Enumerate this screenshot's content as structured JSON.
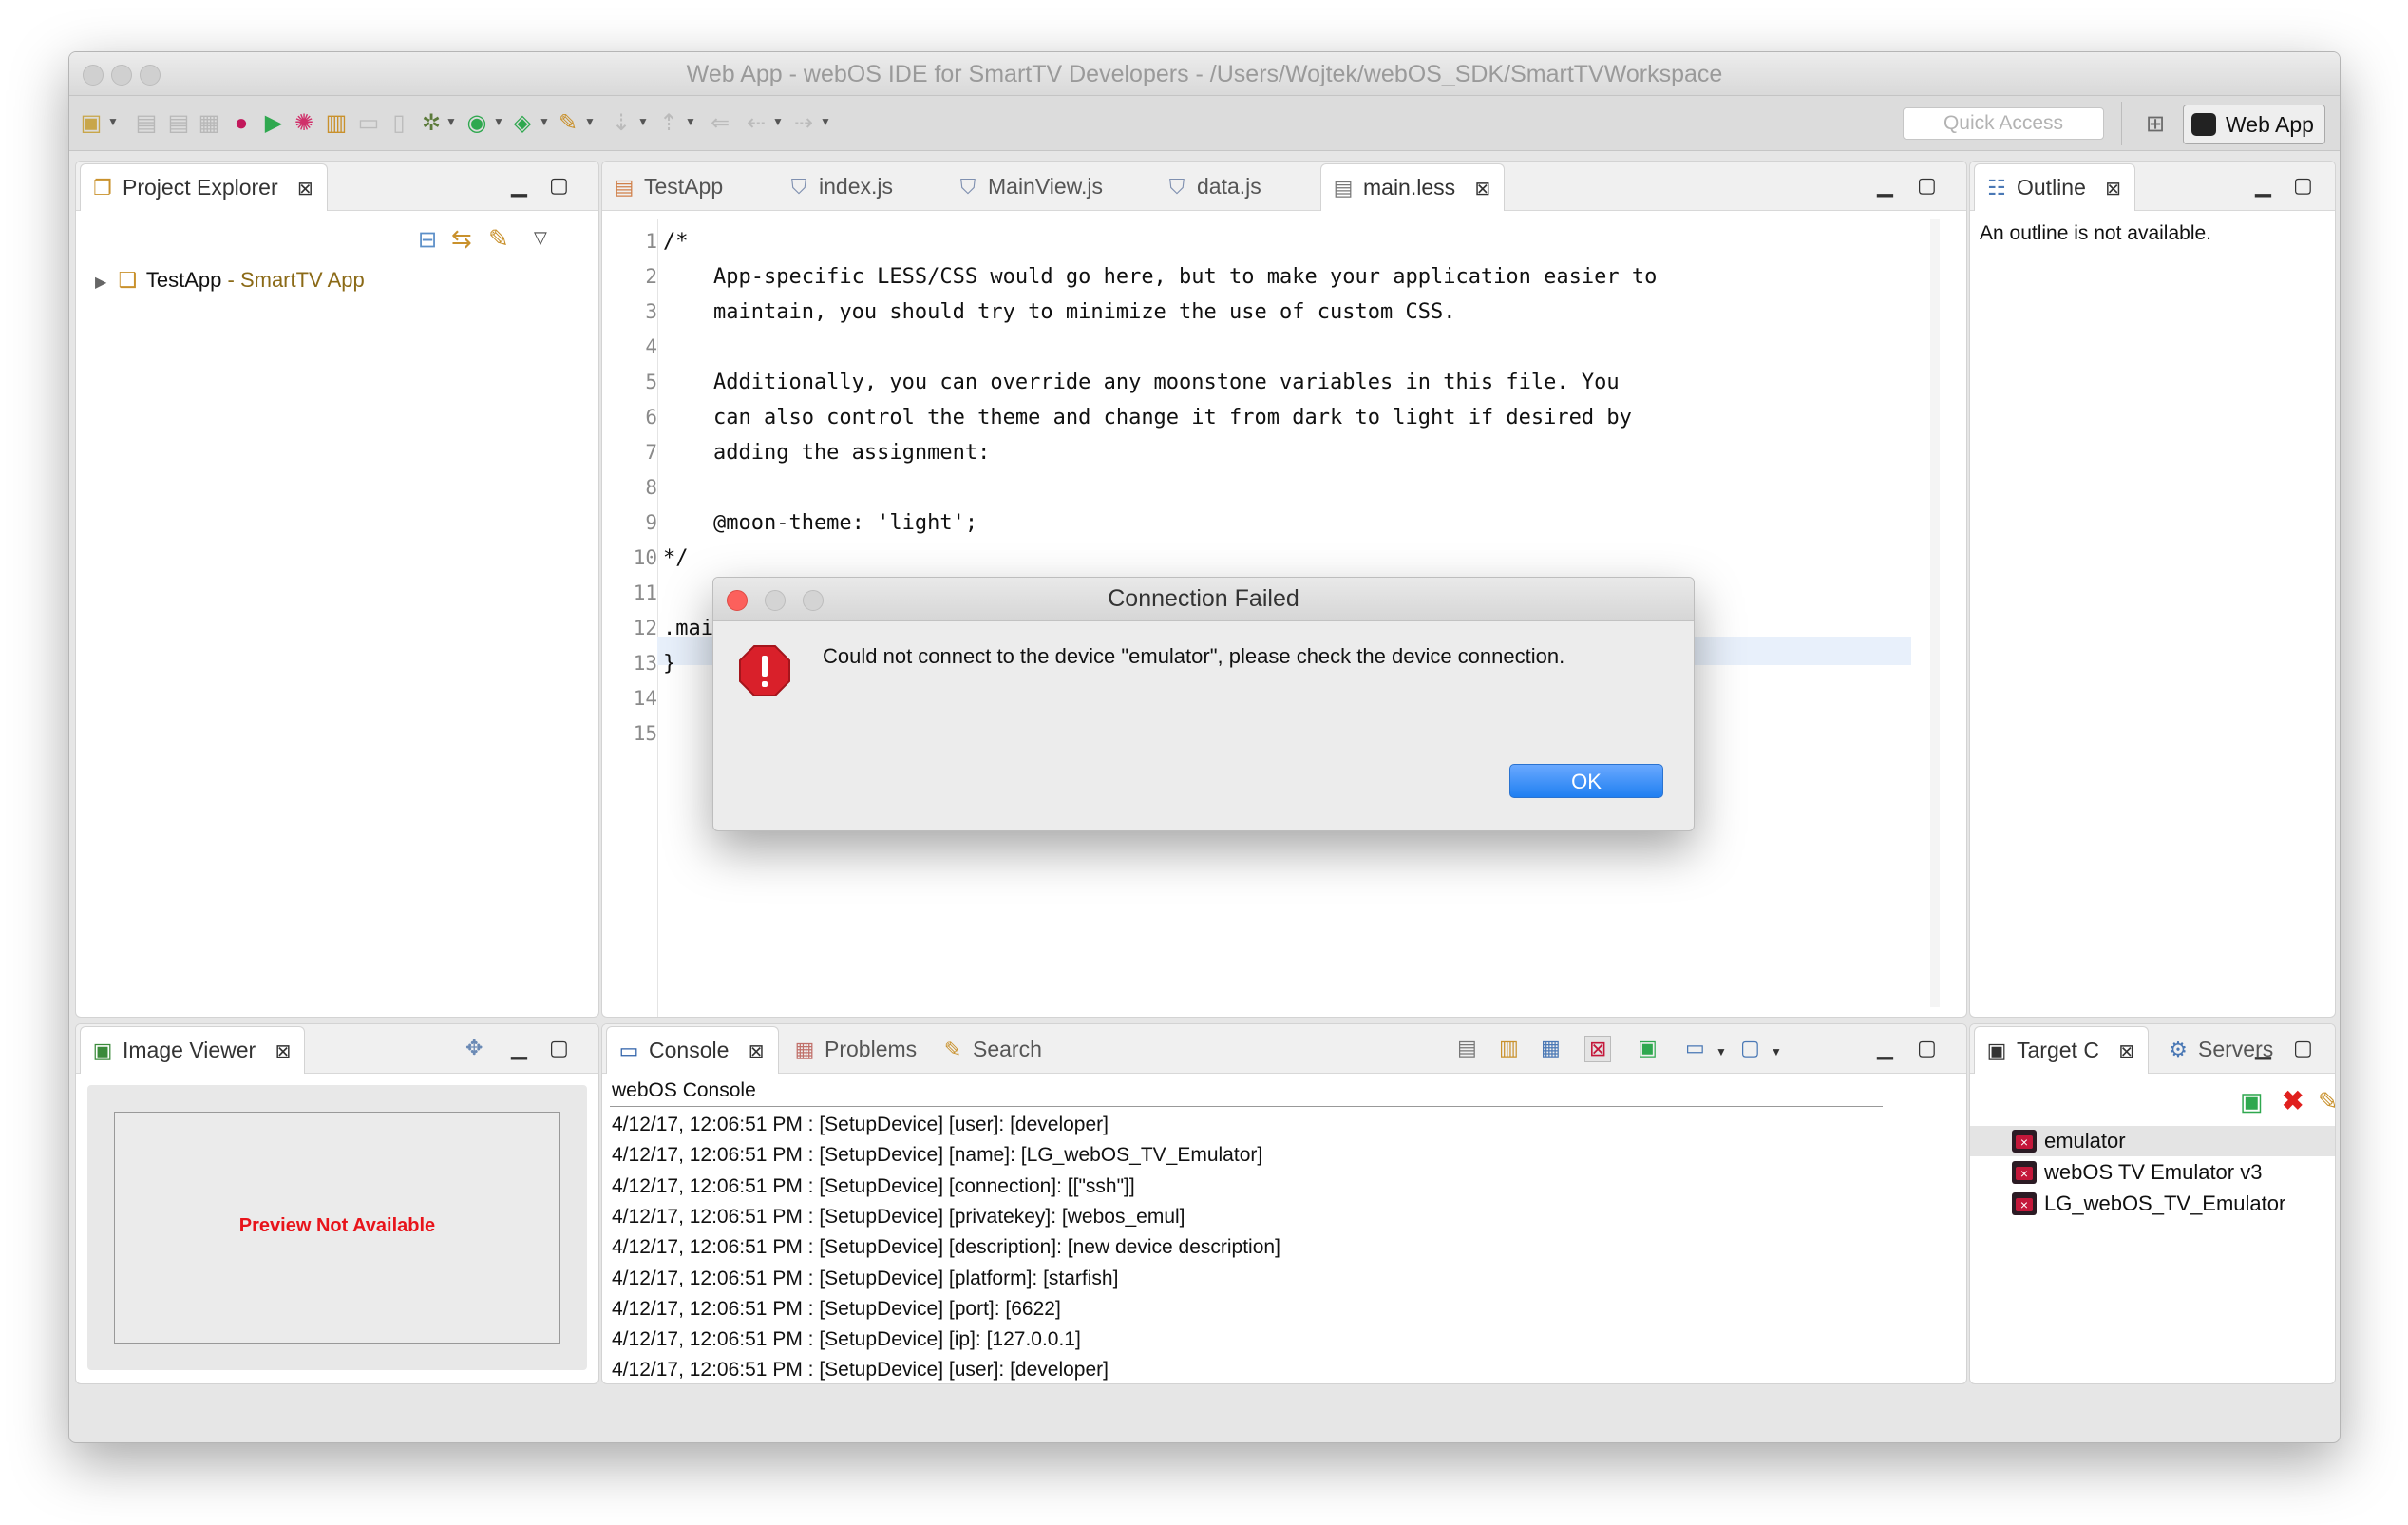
{
  "window": {
    "title": "Web App - webOS IDE for SmartTV Developers - /Users/Wojtek/webOS_SDK/SmartTVWorkspace"
  },
  "toolbar": {
    "quick_access_placeholder": "Quick Access",
    "perspective_label": "Web App"
  },
  "project_explorer": {
    "tab_label": "Project Explorer",
    "tree": [
      {
        "name": "TestApp",
        "decoration": " - SmartTV App"
      }
    ]
  },
  "editor": {
    "tabs": [
      {
        "label": "TestApp",
        "icon": "less-file-icon",
        "active": false
      },
      {
        "label": "index.js",
        "icon": "js-file-icon",
        "active": false
      },
      {
        "label": "MainView.js",
        "icon": "js-file-icon",
        "active": false
      },
      {
        "label": "data.js",
        "icon": "js-file-icon",
        "active": false
      },
      {
        "label": "main.less",
        "icon": "text-file-icon",
        "active": true
      }
    ],
    "lines": [
      "/*",
      "    App-specific LESS/CSS would go here, but to make your application easier to",
      "    maintain, you should try to minimize the use of custom CSS.",
      "",
      "    Additionally, you can override any moonstone variables in this file. You",
      "    can also control the theme and change it from dark to light if desired by",
      "    adding the assignment:",
      "",
      "    @moon-theme: 'light';",
      "*/",
      "",
      ".main-view {",
      "}",
      "",
      ""
    ],
    "line_numbers": [
      "1",
      "2",
      "3",
      "4",
      "5",
      "6",
      "7",
      "8",
      "9",
      "10",
      "11",
      "12",
      "13",
      "14",
      "15"
    ]
  },
  "outline": {
    "tab_label": "Outline",
    "message": "An outline is not available."
  },
  "image_viewer": {
    "tab_label": "Image Viewer",
    "preview_text": "Preview Not Available"
  },
  "console": {
    "tabs": [
      {
        "label": "Console",
        "active": true
      },
      {
        "label": "Problems",
        "active": false
      },
      {
        "label": "Search",
        "active": false
      }
    ],
    "title": "webOS Console",
    "lines": [
      "4/12/17, 12:06:51 PM : [SetupDevice] [user]: [developer]",
      "4/12/17, 12:06:51 PM : [SetupDevice] [name]: [LG_webOS_TV_Emulator]",
      "4/12/17, 12:06:51 PM : [SetupDevice] [connection]: [[\"ssh\"]]",
      "4/12/17, 12:06:51 PM : [SetupDevice] [privatekey]: [webos_emul]",
      "4/12/17, 12:06:51 PM : [SetupDevice] [description]: [new device description]",
      "4/12/17, 12:06:51 PM : [SetupDevice] [platform]: [starfish]",
      "4/12/17, 12:06:51 PM : [SetupDevice] [port]: [6622]",
      "4/12/17, 12:06:51 PM : [SetupDevice] [ip]: [127.0.0.1]",
      "4/12/17, 12:06:51 PM : [SetupDevice] [user]: [developer]"
    ]
  },
  "targets": {
    "tabs": [
      {
        "label": "Target C",
        "active": true
      },
      {
        "label": "Servers",
        "active": false
      }
    ],
    "items": [
      {
        "label": "emulator",
        "selected": true
      },
      {
        "label": "webOS TV Emulator v3",
        "selected": false
      },
      {
        "label": "LG_webOS_TV_Emulator",
        "selected": false
      }
    ]
  },
  "dialog": {
    "title": "Connection Failed",
    "message": "Could not connect to the device \"emulator\", please check the device connection.",
    "ok_label": "OK"
  },
  "colors": {
    "dialog_ok": "#1f7ff1",
    "preview_text": "#e8141b",
    "decoration": "#8b6a17",
    "error_icon": "#d9202a"
  }
}
